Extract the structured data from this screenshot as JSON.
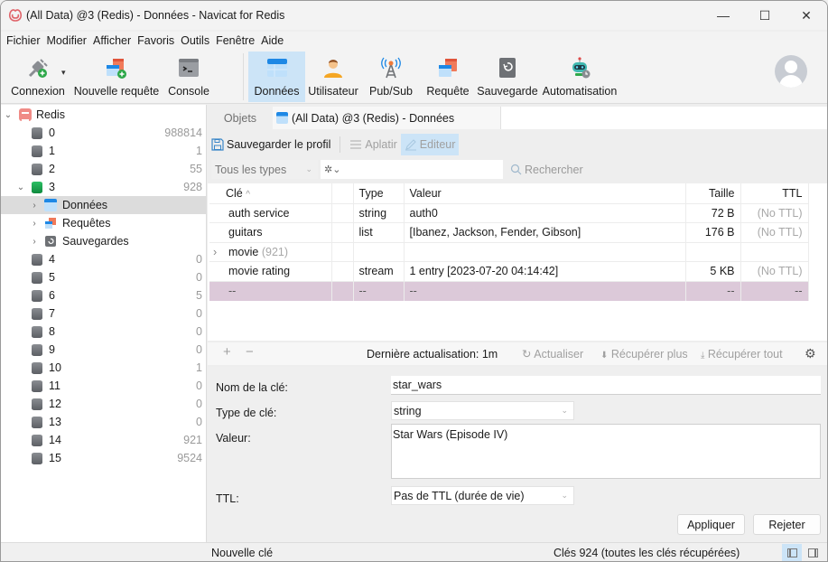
{
  "window": {
    "title": "(All Data) @3 (Redis) - Données - Navicat for Redis",
    "controls": {
      "minimize": "—",
      "maximize": "☐",
      "close": "✕"
    }
  },
  "menu": [
    "Fichier",
    "Modifier",
    "Afficher",
    "Favoris",
    "Outils",
    "Fenêtre",
    "Aide"
  ],
  "toolbar": {
    "buttons": [
      {
        "label": "Connexion",
        "icon": "plug-add-icon",
        "has_dropdown": true
      },
      {
        "label": "Nouvelle requête",
        "icon": "new-query-icon"
      },
      {
        "label": "Console",
        "icon": "console-icon"
      },
      {
        "label": "Données",
        "icon": "data-table-icon",
        "active": true
      },
      {
        "label": "Utilisateur",
        "icon": "user-icon"
      },
      {
        "label": "Pub/Sub",
        "icon": "antenna-icon"
      },
      {
        "label": "Requête",
        "icon": "query-icon"
      },
      {
        "label": "Sauvegarde",
        "icon": "backup-icon"
      },
      {
        "label": "Automatisation",
        "icon": "robot-icon"
      }
    ],
    "dropdown_glyph": "▾"
  },
  "tree": {
    "root": {
      "label": "Redis",
      "expanded": true
    },
    "databases": [
      {
        "name": "0",
        "count": "988814"
      },
      {
        "name": "1",
        "count": "1"
      },
      {
        "name": "2",
        "count": "55"
      },
      {
        "name": "3",
        "count": "928",
        "expanded": true,
        "children": [
          {
            "label": "Données",
            "selected": true
          },
          {
            "label": "Requêtes"
          },
          {
            "label": "Sauvegardes"
          }
        ]
      },
      {
        "name": "4",
        "count": "0"
      },
      {
        "name": "5",
        "count": "0"
      },
      {
        "name": "6",
        "count": "5"
      },
      {
        "name": "7",
        "count": "0"
      },
      {
        "name": "8",
        "count": "0"
      },
      {
        "name": "9",
        "count": "0"
      },
      {
        "name": "10",
        "count": "1"
      },
      {
        "name": "11",
        "count": "0"
      },
      {
        "name": "12",
        "count": "0"
      },
      {
        "name": "13",
        "count": "0"
      },
      {
        "name": "14",
        "count": "921"
      },
      {
        "name": "15",
        "count": "9524"
      }
    ],
    "chevron_down": "⌄",
    "chevron_right": "›"
  },
  "tabs": {
    "objects": "Objets",
    "active": "(All Data) @3 (Redis) - Données"
  },
  "subtoolbar": {
    "save_profile": "Sauvegarder le profil",
    "flatten": "Aplatir",
    "editor": "Editeur"
  },
  "filter": {
    "type_select": "Tous les types",
    "filter_glyph": "✲⌄",
    "search_placeholder": "Rechercher"
  },
  "grid": {
    "columns": [
      "Clé",
      "",
      "Type",
      "Valeur",
      "Taille",
      "TTL"
    ],
    "sort_glyph": "^",
    "rows": [
      {
        "key": "auth service",
        "type": "string",
        "value": "auth0",
        "size": "72 B",
        "ttl": "(No TTL)"
      },
      {
        "key": "guitars",
        "type": "list",
        "value": "[Ibanez, Jackson, Fender, Gibson]",
        "size": "176 B",
        "ttl": "(No TTL)"
      },
      {
        "key": "movie",
        "key_count": "(921)",
        "group": true,
        "type": "",
        "value": "",
        "size": "",
        "ttl": ""
      },
      {
        "key": "movie rating",
        "type": "stream",
        "value": "1 entry [2023-07-20 04:14:42]",
        "size": "5 KB",
        "ttl": "(No TTL)"
      },
      {
        "key": "--",
        "type": "--",
        "value": "--",
        "size": "--",
        "ttl": "--",
        "new": true
      }
    ]
  },
  "grid_footer": {
    "add": "+",
    "remove": "−",
    "last_refresh": "Dernière actualisation: 1m",
    "refresh": "Actualiser",
    "fetch_more": "Récupérer plus",
    "fetch_all": "Récupérer tout",
    "settings_glyph": "⚙"
  },
  "editor": {
    "key_name_label": "Nom de la clé:",
    "key_name_value": "star_wars",
    "key_type_label": "Type de clé:",
    "key_type_value": "string",
    "value_label": "Valeur:",
    "value_value": "Star Wars (Episode IV)",
    "ttl_label": "TTL:",
    "ttl_value": "Pas de TTL (durée de vie)",
    "apply": "Appliquer",
    "discard": "Rejeter"
  },
  "status": {
    "left": "Nouvelle clé",
    "right": "Clés 924 (toutes les clés récupérées)"
  },
  "colors": {
    "accent_active": "#cce4f7",
    "new_row": "#dcc9d9",
    "db_active": "#1fa653",
    "redis_brand": "#f08b86"
  }
}
